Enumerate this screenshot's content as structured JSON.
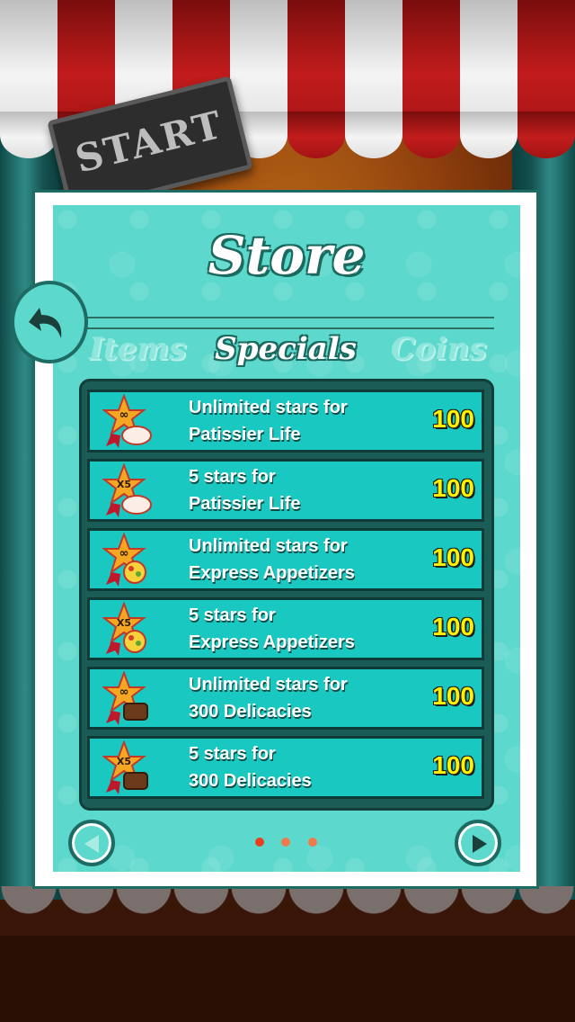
{
  "background": {
    "sign_text": "START"
  },
  "store": {
    "title": "Store",
    "tabs": [
      {
        "label": "Items",
        "active": false
      },
      {
        "label": "Specials",
        "active": true
      },
      {
        "label": "Coins",
        "active": false
      }
    ],
    "items": [
      {
        "line1": "Unlimited stars for",
        "line2": "Patissier Life",
        "price": "100",
        "badge": "∞",
        "icon": "cake-star-icon"
      },
      {
        "line1": "5 stars for",
        "line2": "Patissier Life",
        "price": "100",
        "badge": "X5",
        "icon": "cake-star-icon"
      },
      {
        "line1": "Unlimited stars for",
        "line2": "Express Appetizers",
        "price": "100",
        "badge": "∞",
        "icon": "appetizer-star-icon"
      },
      {
        "line1": "5 stars for",
        "line2": "Express Appetizers",
        "price": "100",
        "badge": "X5",
        "icon": "appetizer-star-icon"
      },
      {
        "line1": "Unlimited stars for",
        "line2": "300 Delicacies",
        "price": "100",
        "badge": "∞",
        "icon": "delicacy-star-icon"
      },
      {
        "line1": "5 stars for",
        "line2": "300 Delicacies",
        "price": "100",
        "badge": "X5",
        "icon": "delicacy-star-icon"
      }
    ],
    "pagination": {
      "pages": 3,
      "current": 1
    }
  },
  "colors": {
    "panel": "#5dd8cc",
    "row": "#19c8c0",
    "price": "#fff200",
    "dot_active": "#e8401c",
    "dot_inactive": "#f07a4a"
  }
}
